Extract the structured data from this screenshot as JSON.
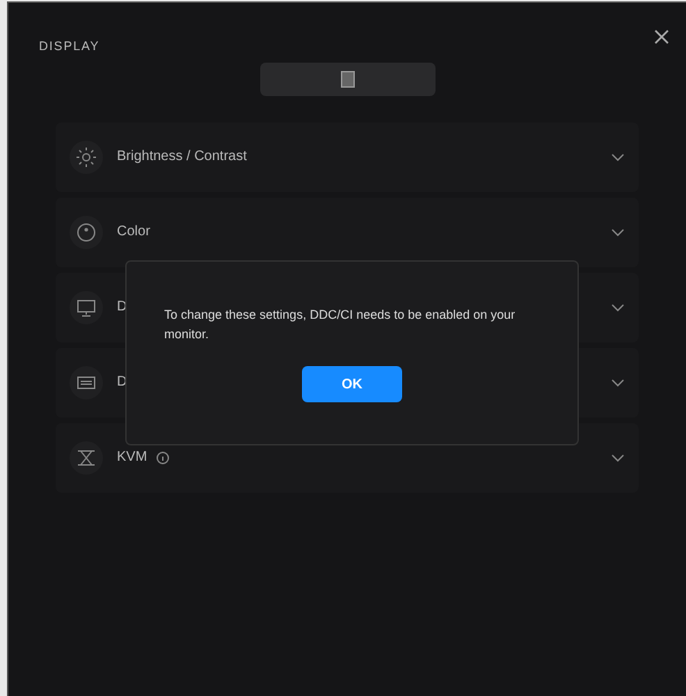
{
  "window": {
    "title": "DISPLAY"
  },
  "selector": {
    "kind": "monitor"
  },
  "sections": [
    {
      "kind": "brightness",
      "label": "Brightness / Contrast",
      "expanded": false
    },
    {
      "kind": "color",
      "label": "Color",
      "expanded": false
    },
    {
      "kind": "display",
      "label": "D",
      "expanded": false
    },
    {
      "kind": "input",
      "label": "D",
      "expanded": false
    },
    {
      "kind": "kvm",
      "label": "KVM",
      "info": true,
      "expanded": false
    }
  ],
  "dialog": {
    "message": "To change these settings, DDC/CI needs to be enabled on your monitor.",
    "button": "OK"
  }
}
